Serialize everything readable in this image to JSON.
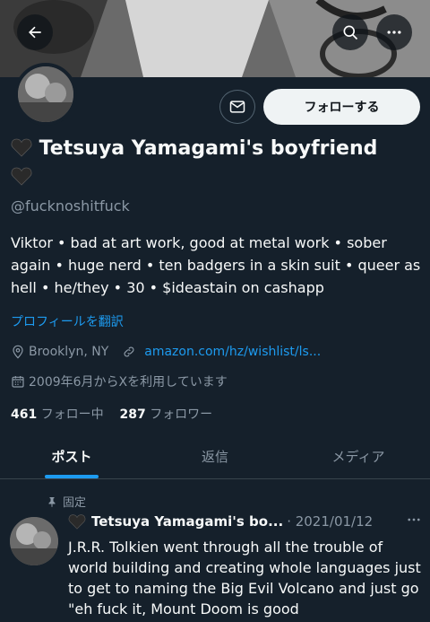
{
  "header": {
    "back_icon": "arrow-left-icon",
    "search_icon": "search-icon",
    "more_icon": "more-horizontal-icon"
  },
  "profile": {
    "display_name": "Tetsuya Yamagami's boyfriend",
    "handle": "@fucknoshitfuck",
    "bio": "Viktor • bad at art work, good at metal work • sober again • huge nerd • ten badgers in a skin suit • queer as hell • he/they • 30 • $ideastain on cashapp",
    "translate_label": "プロフィールを翻訳",
    "location": "Brooklyn, NY",
    "website": "amazon.com/hz/wishlist/ls...",
    "joined": "2009年6月からXを利用しています",
    "following_count": "461",
    "following_label": "フォロー中",
    "followers_count": "287",
    "followers_label": "フォロワー"
  },
  "actions": {
    "message_icon": "mail-icon",
    "follow_label": "フォローする"
  },
  "tabs": [
    {
      "label": "ポスト"
    },
    {
      "label": "返信"
    },
    {
      "label": "メディア"
    }
  ],
  "pinned_post": {
    "pinned_label": "固定",
    "author": "Tetsuya Yamagami's bo...",
    "date": "· 2021/01/12",
    "text": "J.R.R. Tolkien went through all the trouble of world building and creating whole languages just to get to naming the Big Evil Volcano and just go \"eh fuck it, Mount Doom is good"
  },
  "colors": {
    "background": "#15202b",
    "accent": "#1d9bf0",
    "secondary_text": "#8b98a5"
  }
}
